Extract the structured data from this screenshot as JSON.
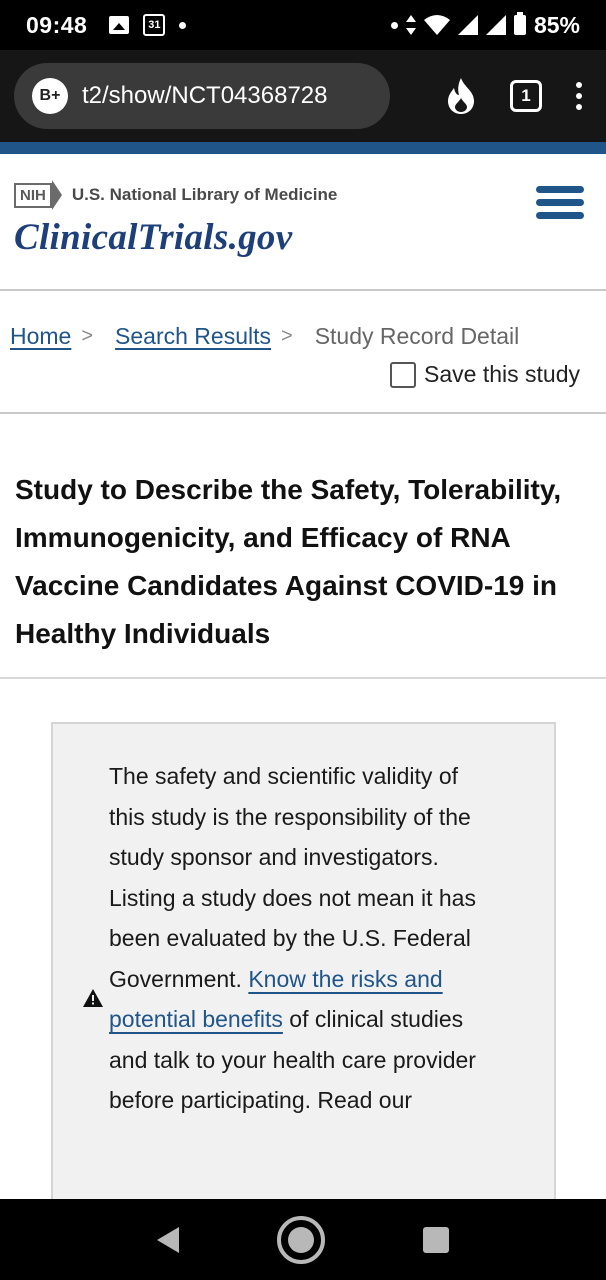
{
  "status_bar": {
    "time": "09:48",
    "calendar_day": "31",
    "battery": "85%",
    "icons": [
      "image-icon",
      "calendar-icon",
      "dot-icon",
      "dot-icon",
      "data-arrows-icon",
      "wifi-icon",
      "signal-icon",
      "signal-icon",
      "battery-icon"
    ]
  },
  "browser": {
    "site_badge": "B+",
    "url": "t2/show/NCT04368728",
    "tab_count": "1",
    "icons": [
      "flame-icon",
      "tabs-icon",
      "more-vert-icon"
    ]
  },
  "header": {
    "nih_badge": "NIH",
    "org_name": "U.S. National Library of Medicine",
    "site_logo": "ClinicalTrials.gov",
    "menu_icon": "hamburger-menu-icon",
    "accent_color": "#20558a"
  },
  "breadcrumb": {
    "home": "Home",
    "search_results": "Search Results",
    "current": "Study Record Detail",
    "separator": ">"
  },
  "save_study": {
    "label": "Save this study",
    "checked": false
  },
  "study": {
    "title": "Study to Describe the Safety, Tolerability, Immunogenicity, and Efficacy of RNA Vaccine Candidates Against COVID-19 in Healthy Individuals"
  },
  "disclaimer": {
    "icon": "warning-icon",
    "text_before": "The safety and scientific validity of this study is the responsibility of the study sponsor and investigators. Listing a study does not mean it has been evaluated by the U.S. Federal Government. ",
    "link_text": "Know the risks and potential benefits",
    "text_after": " of clinical studies and talk to your health care provider before participating. Read our"
  },
  "nav_bar": {
    "icons": [
      "back-icon",
      "home-icon",
      "recents-icon"
    ]
  }
}
